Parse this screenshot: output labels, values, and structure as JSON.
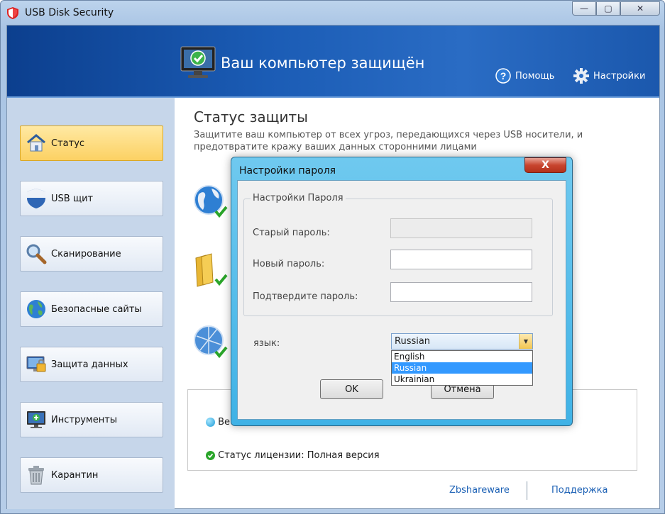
{
  "window": {
    "title": "USB Disk Security",
    "minimize": "—",
    "maximize": "▢",
    "close": "✕"
  },
  "header": {
    "status": "Ваш компьютер защищён",
    "help": "Помощь",
    "settings": "Настройки"
  },
  "sidebar": {
    "items": [
      {
        "label": "Статус",
        "icon": "house-icon",
        "active": true
      },
      {
        "label": "USB щит",
        "icon": "shield-icon",
        "active": false
      },
      {
        "label": "Сканирование",
        "icon": "magnifier-icon",
        "active": false
      },
      {
        "label": "Безопасные сайты",
        "icon": "globe-icon",
        "active": false
      },
      {
        "label": "Защита данных",
        "icon": "data-protection-icon",
        "active": false
      },
      {
        "label": "Инструменты",
        "icon": "tools-monitor-icon",
        "active": false
      },
      {
        "label": "Карантин",
        "icon": "trash-icon",
        "active": false
      }
    ]
  },
  "main": {
    "title": "Статус защиты",
    "description": "Защитите ваш компьютер от всех угроз, передающихся через USB носители, и предотвратите кражу ваших данных сторонними лицами",
    "info_line1": "Ве",
    "info_line2": "Статус лицензии: Полная версия",
    "footer_left": "Zbshareware",
    "footer_right": "Поддержка"
  },
  "dialog": {
    "title": "Настройки пароля",
    "close": "X",
    "group_title": "Настройки Пароля",
    "old_password_label": "Старый пароль:",
    "new_password_label": "Новый пароль:",
    "confirm_password_label": "Подтвердите пароль:",
    "old_password_value": "",
    "new_password_value": "",
    "confirm_password_value": "",
    "language_label": "язык:",
    "language_selected": "Russian",
    "language_options": [
      "English",
      "Russian",
      "Ukrainian"
    ],
    "ok": "OK",
    "cancel": "Отмена"
  },
  "colors": {
    "banner": "#1b5cb5",
    "active_nav": "#fcd163",
    "dialog_frame": "#3fb2e6",
    "link": "#1a5fb4",
    "check_green": "#2aa52a"
  }
}
